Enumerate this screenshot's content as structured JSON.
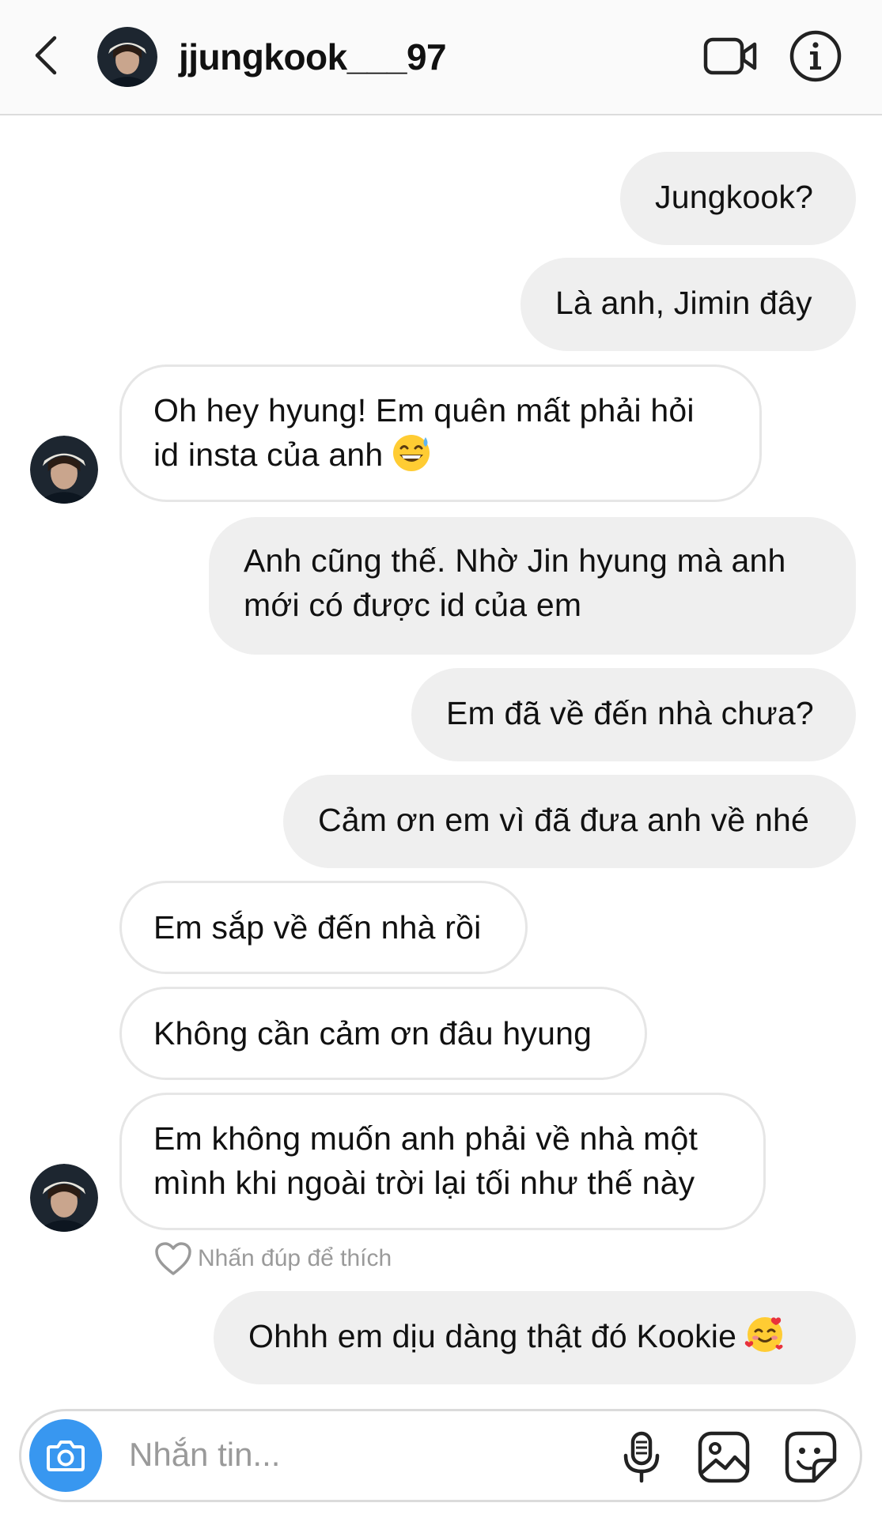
{
  "header": {
    "username": "jjungkook___97",
    "back_icon": "chevron-left-icon",
    "video_icon": "video-camera-icon",
    "info_icon": "info-icon"
  },
  "messages": [
    {
      "from": "me",
      "lines": [
        "Jungkook?"
      ]
    },
    {
      "from": "me",
      "lines": [
        "Là anh, Jimin đây"
      ]
    },
    {
      "from": "them",
      "lines": [
        "Oh hey hyung! Em quên mất phải hỏi",
        "id insta của anh"
      ],
      "emoji": "grinning-sweat-emoji"
    },
    {
      "from": "me",
      "lines": [
        "Anh cũng thế. Nhờ Jin hyung mà anh",
        "mới có được id của em"
      ]
    },
    {
      "from": "me",
      "lines": [
        "Em đã về đến nhà chưa?"
      ]
    },
    {
      "from": "me",
      "lines": [
        "Cảm ơn em vì đã đưa anh về nhé"
      ]
    },
    {
      "from": "them",
      "lines": [
        "Em sắp về đến nhà rồi"
      ]
    },
    {
      "from": "them",
      "lines": [
        "Không cần cảm ơn đâu hyung"
      ]
    },
    {
      "from": "them",
      "lines": [
        "Em không muốn anh phải về nhà một",
        "mình khi ngoài trời lại tối như thế này"
      ]
    },
    {
      "from": "me",
      "lines": [
        "Ohhh em dịu dàng thật đó Kookie"
      ],
      "emoji": "smiling-hearts-emoji"
    }
  ],
  "like_hint": "Nhấn đúp để thích",
  "composer": {
    "placeholder": "Nhắn tin...",
    "value": "",
    "camera_icon": "camera-icon",
    "mic_icon": "microphone-icon",
    "gallery_icon": "gallery-icon",
    "sticker_icon": "sticker-icon"
  },
  "colors": {
    "accent": "#3897f0",
    "sent_bubble": "#efefef",
    "received_border": "#e6e6e6",
    "muted_text": "#9a9a9a",
    "header_bg": "#fafafa"
  }
}
